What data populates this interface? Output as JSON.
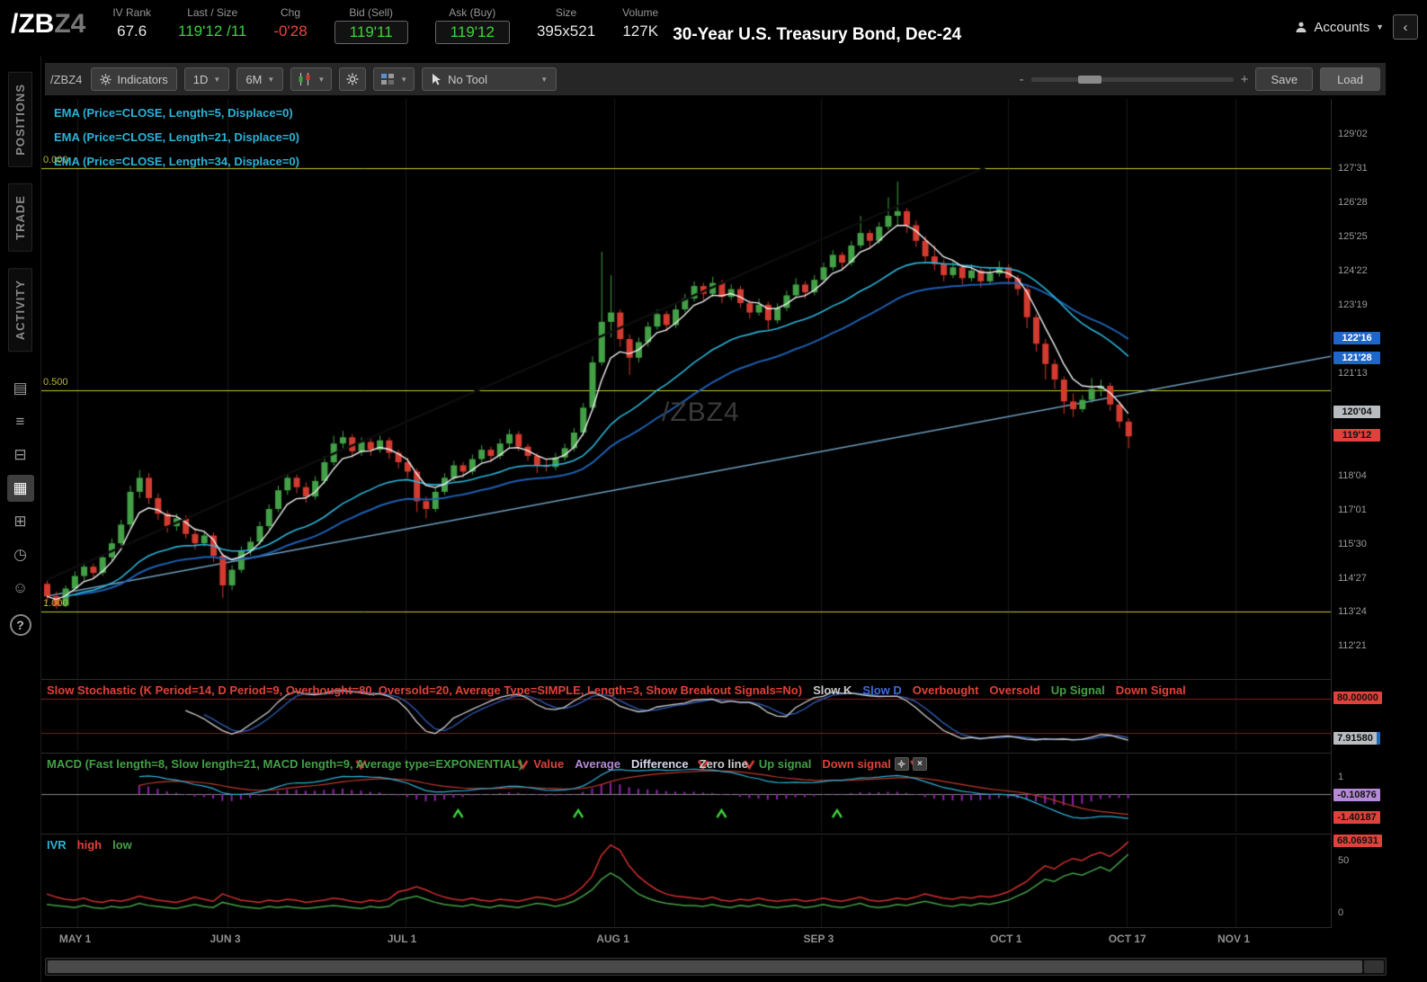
{
  "colors": {
    "up": "#43a047",
    "down": "#d23b30",
    "green_text": "#3fd13f",
    "red_text": "#e8483f",
    "ema5": "#f0f0f0",
    "ema21": "#2bb3d8",
    "ema34": "#1d5fb0",
    "yellow_level": "#c9c92a",
    "support_line": "#6f9fc0",
    "dark_trendline": "#0d0d0d",
    "stoch_k": "#cfcfcf",
    "stoch_d": "#2f5fb8",
    "stoch_band": "#7f1f1f",
    "macd_value": "#2bb3d8",
    "macd_avg": "#c0392b",
    "macd_hist": "#8e24aa",
    "ivr_high": "#d32f2f",
    "ivr_low": "#43a047",
    "badge_blue": "#1f66c9",
    "badge_gray": "#b9bdc2",
    "badge_red": "#e0413a",
    "badge_purple": "#b48ad6",
    "grid": "#181818"
  },
  "header": {
    "symbol_main": "/ZB",
    "symbol_suffix": "Z4",
    "stats": [
      {
        "label": "IV Rank",
        "value": "67.6",
        "style": "white"
      },
      {
        "label": "Last / Size",
        "value": "119'12 /11",
        "style": "green"
      },
      {
        "label": "Chg",
        "value": "-0'28",
        "style": "red"
      },
      {
        "label": "Bid (Sell)",
        "value": "119'11",
        "style": "green",
        "boxed": true
      },
      {
        "label": "Ask (Buy)",
        "value": "119'12",
        "style": "green",
        "boxed": true
      },
      {
        "label": "Size",
        "value": "395x521",
        "style": "white"
      },
      {
        "label": "Volume",
        "value": "127K",
        "style": "white"
      }
    ],
    "title": "30-Year U.S. Treasury Bond, Dec-24",
    "accounts_label": "Accounts",
    "collapse_glyph": "‹"
  },
  "sidebar": {
    "tabs": [
      "POSITIONS",
      "TRADE",
      "ACTIVITY"
    ],
    "icons": [
      {
        "name": "report-icon",
        "glyph": "▤",
        "active": false
      },
      {
        "name": "list-icon",
        "glyph": "≡",
        "active": false
      },
      {
        "name": "orders-icon",
        "glyph": "⊟",
        "active": false
      },
      {
        "name": "chart-icon",
        "glyph": "▦",
        "active": true
      },
      {
        "name": "dashboard-grid-icon",
        "glyph": "⊞",
        "active": false
      },
      {
        "name": "history-clock-icon",
        "glyph": "◷",
        "active": false
      },
      {
        "name": "clients-icon",
        "glyph": "☺",
        "active": false
      }
    ],
    "help_label": "?"
  },
  "toolbar": {
    "symbol": "/ZBZ4",
    "indicators_label": "Indicators",
    "timeframe": "1D",
    "range": "6M",
    "tool_label": "No Tool",
    "zoom_minus": "-",
    "zoom_plus": "+",
    "save_label": "Save",
    "load_label": "Load"
  },
  "chart": {
    "watermark": "/ZBZ4",
    "ema_labels": [
      "EMA (Price=CLOSE, Length=5, Displace=0)",
      "EMA (Price=CLOSE, Length=21, Displace=0)",
      "EMA (Price=CLOSE, Length=34, Displace=0)"
    ],
    "fib_levels": [
      {
        "label": "0.000",
        "price": 127.969
      },
      {
        "label": "0.500",
        "price": 120.859
      },
      {
        "label": "1.000",
        "price": 113.75
      }
    ],
    "axis_ticks": [
      {
        "label": "129'02",
        "price": 129.0625
      },
      {
        "label": "127'31",
        "price": 127.96875
      },
      {
        "label": "126'28",
        "price": 126.875
      },
      {
        "label": "125'25",
        "price": 125.78125
      },
      {
        "label": "124'22",
        "price": 124.6875
      },
      {
        "label": "123'19",
        "price": 123.59375
      },
      {
        "label": "121'13",
        "price": 121.40625
      },
      {
        "label": "118'04",
        "price": 118.125
      },
      {
        "label": "117'01",
        "price": 117.03125
      },
      {
        "label": "115'30",
        "price": 115.9375
      },
      {
        "label": "114'27",
        "price": 114.84375
      },
      {
        "label": "113'24",
        "price": 113.75
      },
      {
        "label": "112'21",
        "price": 112.65625
      }
    ],
    "axis_badges": [
      {
        "label": "122'16",
        "price": 122.5,
        "bg": "#1f66c9",
        "fg": "#fff"
      },
      {
        "label": "121'28",
        "price": 121.875,
        "bg": "#1f66c9",
        "fg": "#fff"
      },
      {
        "label": "120'04",
        "price": 120.125,
        "bg": "#b9bdc2",
        "fg": "#111"
      },
      {
        "label": "119'12",
        "price": 119.375,
        "bg": "#e0413a",
        "fg": "#111"
      }
    ],
    "price_top": 130.2,
    "price_bottom": 111.6
  },
  "stoch": {
    "title": "Slow Stochastic (K Period=14, D Period=9, Overbought=80, Oversold=20, Average Type=SIMPLE, Length=3, Show Breakout Signals=No)",
    "legend": [
      {
        "text": "Slow K",
        "color": "#c8c8c8"
      },
      {
        "text": "Slow D",
        "color": "#3f6bd8"
      },
      {
        "text": "Overbought",
        "color": "#e0413a"
      },
      {
        "text": "Oversold",
        "color": "#e0413a"
      },
      {
        "text": "Up Signal",
        "color": "#43a047"
      },
      {
        "text": "Down Signal",
        "color": "#e0413a"
      }
    ],
    "overbought": 80,
    "oversold": 20,
    "badges": [
      {
        "label": "80.00000",
        "value": 80,
        "bg": "#e0413a",
        "fg": "#111"
      },
      {
        "label": "7.91580",
        "value": 7.9158,
        "bg": "#b9bdc2",
        "fg": "#111",
        "edge": "#1f66c9"
      }
    ]
  },
  "macd": {
    "title": "MACD (Fast length=8, Slow length=21, MACD length=9, Average type=EXPONENTIAL)",
    "legend": [
      {
        "text": "Value",
        "color": "#e0413a"
      },
      {
        "text": "Average",
        "color": "#b48ad6"
      },
      {
        "text": "Difference",
        "color": "#d8d8ee"
      },
      {
        "text": "Zero line",
        "color": "#cccccc"
      },
      {
        "text": "Up signal",
        "color": "#43a047"
      },
      {
        "text": "Down signal",
        "color": "#e0413a"
      }
    ],
    "close_glyph": "×",
    "axis_plain": [
      {
        "label": "1",
        "value": 1
      }
    ],
    "badges": [
      {
        "label": "-0.10876",
        "value": -0.10876,
        "bg": "#b48ad6",
        "fg": "#111"
      },
      {
        "label": "-1.40187",
        "value": -1.40187,
        "bg": "#e0413a",
        "fg": "#111"
      }
    ],
    "up_signals": [
      44.5,
      57.5,
      73,
      85.5
    ],
    "down_signals": [
      34,
      51.5,
      71,
      76,
      94
    ]
  },
  "ivr": {
    "title": "IVR",
    "legend": [
      {
        "text": "high",
        "color": "#e0413a"
      },
      {
        "text": "low",
        "color": "#43a047"
      }
    ],
    "axis_plain": [
      {
        "label": "50",
        "value": 50
      },
      {
        "label": "0",
        "value": 0
      }
    ],
    "badges": [
      {
        "label": "68.06931",
        "value": 68.069,
        "bg": "#e0413a",
        "fg": "#111"
      }
    ]
  },
  "chart_data": {
    "type": "candlestick",
    "symbol": "/ZBZ4",
    "title": "30-Year U.S. Treasury Bond, Dec-24, 1D 6M",
    "ylim": [
      111.6,
      130.2
    ],
    "month_ticks": [
      {
        "label": "MAY 1",
        "index": 3.3
      },
      {
        "label": "JUN 3",
        "index": 19.6
      },
      {
        "label": "JUL 1",
        "index": 38.8
      },
      {
        "label": "AUG 1",
        "index": 61.4
      },
      {
        "label": "SEP 3",
        "index": 83.8
      },
      {
        "label": "OCT 1",
        "index": 104
      },
      {
        "label": "OCT 17",
        "index": 116.8
      },
      {
        "label": "NOV 1",
        "index": 128.6
      }
    ],
    "trendlines": [
      {
        "name": "support-trendline",
        "color": "#6f9fc0",
        "width": 1.5,
        "from": {
          "i": 0,
          "p": 114.25
        },
        "to": {
          "i": 139,
          "p": 121.95
        }
      },
      {
        "name": "dark-trendline",
        "color": "#0d0d0d",
        "width": 2.5,
        "from": {
          "i": 0,
          "p": 114.78
        },
        "to": {
          "i": 101.5,
          "p": 128.0
        }
      }
    ],
    "candles": [
      [
        114.65,
        114.75,
        114.05,
        114.25
      ],
      [
        114.25,
        114.4,
        113.85,
        113.95
      ],
      [
        113.95,
        114.6,
        113.9,
        114.5
      ],
      [
        114.5,
        115.05,
        114.4,
        114.9
      ],
      [
        114.9,
        115.35,
        114.75,
        115.2
      ],
      [
        115.2,
        115.3,
        114.85,
        115.0
      ],
      [
        115.0,
        115.6,
        114.9,
        115.5
      ],
      [
        115.5,
        116.1,
        115.4,
        115.95
      ],
      [
        115.95,
        116.7,
        115.85,
        116.55
      ],
      [
        116.55,
        117.8,
        116.45,
        117.6
      ],
      [
        117.6,
        118.3,
        117.4,
        118.05
      ],
      [
        118.05,
        118.2,
        117.2,
        117.4
      ],
      [
        117.4,
        117.55,
        116.7,
        116.9
      ],
      [
        116.9,
        117.0,
        116.3,
        116.5
      ],
      [
        116.5,
        116.9,
        116.35,
        116.75
      ],
      [
        116.75,
        116.85,
        116.1,
        116.25
      ],
      [
        116.25,
        116.45,
        115.75,
        115.95
      ],
      [
        115.95,
        116.35,
        115.85,
        116.2
      ],
      [
        116.2,
        116.3,
        115.35,
        115.55
      ],
      [
        115.55,
        115.65,
        114.2,
        114.6
      ],
      [
        114.6,
        115.25,
        114.45,
        115.1
      ],
      [
        115.1,
        115.85,
        115.0,
        115.7
      ],
      [
        115.7,
        116.15,
        115.55,
        116.0
      ],
      [
        116.0,
        116.65,
        115.9,
        116.5
      ],
      [
        116.5,
        117.2,
        116.4,
        117.05
      ],
      [
        117.05,
        117.8,
        116.95,
        117.65
      ],
      [
        117.65,
        118.2,
        117.5,
        118.05
      ],
      [
        118.05,
        118.15,
        117.55,
        117.75
      ],
      [
        117.75,
        117.9,
        117.25,
        117.45
      ],
      [
        117.45,
        118.1,
        117.35,
        117.95
      ],
      [
        117.95,
        118.75,
        117.85,
        118.55
      ],
      [
        118.55,
        119.4,
        118.45,
        119.15
      ],
      [
        119.15,
        119.55,
        119.0,
        119.35
      ],
      [
        119.35,
        119.45,
        118.7,
        118.9
      ],
      [
        118.9,
        119.35,
        118.75,
        119.2
      ],
      [
        119.2,
        119.3,
        118.75,
        118.95
      ],
      [
        118.95,
        119.4,
        118.85,
        119.25
      ],
      [
        119.25,
        119.35,
        118.65,
        118.85
      ],
      [
        118.85,
        118.95,
        118.35,
        118.55
      ],
      [
        118.55,
        118.7,
        118.05,
        118.25
      ],
      [
        118.25,
        118.35,
        116.95,
        117.3
      ],
      [
        117.3,
        117.45,
        116.75,
        117.05
      ],
      [
        117.05,
        117.75,
        116.95,
        117.6
      ],
      [
        117.6,
        118.2,
        117.5,
        118.05
      ],
      [
        118.05,
        118.6,
        117.95,
        118.45
      ],
      [
        118.45,
        118.55,
        118.05,
        118.25
      ],
      [
        118.25,
        118.8,
        118.15,
        118.65
      ],
      [
        118.65,
        119.1,
        118.55,
        118.95
      ],
      [
        118.95,
        119.05,
        118.55,
        118.75
      ],
      [
        118.75,
        119.3,
        118.65,
        119.15
      ],
      [
        119.15,
        119.6,
        119.0,
        119.45
      ],
      [
        119.45,
        119.55,
        118.9,
        119.05
      ],
      [
        119.05,
        119.15,
        118.6,
        118.75
      ],
      [
        118.75,
        118.85,
        118.2,
        118.45
      ],
      [
        118.45,
        118.65,
        118.25,
        118.4
      ],
      [
        118.4,
        118.85,
        118.3,
        118.7
      ],
      [
        118.7,
        119.15,
        118.6,
        119.0
      ],
      [
        119.0,
        119.65,
        118.9,
        119.5
      ],
      [
        119.5,
        120.45,
        119.4,
        120.3
      ],
      [
        120.3,
        121.95,
        120.2,
        121.75
      ],
      [
        121.75,
        125.3,
        121.65,
        123.05
      ],
      [
        123.05,
        124.55,
        122.55,
        123.35
      ],
      [
        123.35,
        123.45,
        122.25,
        122.5
      ],
      [
        122.5,
        122.65,
        121.35,
        121.9
      ],
      [
        121.9,
        122.55,
        121.75,
        122.4
      ],
      [
        122.4,
        123.05,
        122.25,
        122.9
      ],
      [
        122.9,
        123.45,
        122.8,
        123.3
      ],
      [
        123.3,
        123.4,
        122.75,
        122.95
      ],
      [
        122.95,
        123.6,
        122.85,
        123.45
      ],
      [
        123.45,
        123.95,
        123.35,
        123.8
      ],
      [
        123.8,
        124.35,
        123.7,
        124.2
      ],
      [
        124.2,
        124.3,
        123.75,
        123.95
      ],
      [
        123.95,
        124.5,
        123.85,
        124.3
      ],
      [
        124.3,
        124.4,
        123.65,
        123.85
      ],
      [
        123.85,
        124.25,
        123.75,
        124.1
      ],
      [
        124.1,
        124.2,
        123.5,
        123.65
      ],
      [
        123.65,
        123.75,
        123.15,
        123.35
      ],
      [
        123.35,
        123.8,
        123.25,
        123.6
      ],
      [
        123.6,
        123.7,
        122.8,
        123.1
      ],
      [
        123.1,
        123.65,
        123.0,
        123.5
      ],
      [
        123.5,
        124.05,
        123.4,
        123.9
      ],
      [
        123.9,
        124.45,
        123.8,
        124.25
      ],
      [
        124.25,
        124.35,
        123.8,
        124.0
      ],
      [
        124.0,
        124.55,
        123.9,
        124.4
      ],
      [
        124.4,
        124.95,
        124.3,
        124.8
      ],
      [
        124.8,
        125.35,
        124.7,
        125.2
      ],
      [
        125.2,
        125.3,
        124.75,
        124.95
      ],
      [
        124.95,
        125.65,
        124.85,
        125.5
      ],
      [
        125.5,
        126.45,
        125.4,
        125.9
      ],
      [
        125.9,
        126.0,
        125.4,
        125.65
      ],
      [
        125.65,
        126.25,
        125.55,
        126.1
      ],
      [
        126.1,
        127.05,
        126.0,
        126.45
      ],
      [
        126.45,
        127.55,
        126.15,
        126.6
      ],
      [
        126.6,
        126.7,
        125.9,
        126.15
      ],
      [
        126.15,
        126.3,
        125.45,
        125.65
      ],
      [
        125.65,
        125.8,
        124.95,
        125.15
      ],
      [
        125.15,
        125.5,
        124.7,
        124.9
      ],
      [
        124.9,
        125.05,
        124.35,
        124.55
      ],
      [
        124.55,
        125.0,
        124.45,
        124.8
      ],
      [
        124.8,
        124.9,
        124.25,
        124.45
      ],
      [
        124.45,
        124.9,
        124.35,
        124.7
      ],
      [
        124.7,
        124.8,
        124.15,
        124.35
      ],
      [
        124.35,
        124.8,
        124.25,
        124.6
      ],
      [
        124.6,
        125.0,
        124.5,
        124.8
      ],
      [
        124.8,
        124.9,
        124.25,
        124.45
      ],
      [
        124.45,
        124.55,
        123.9,
        124.1
      ],
      [
        124.1,
        124.2,
        122.85,
        123.2
      ],
      [
        123.2,
        123.3,
        122.1,
        122.35
      ],
      [
        122.35,
        122.5,
        121.2,
        121.7
      ],
      [
        121.7,
        121.85,
        120.9,
        121.2
      ],
      [
        121.2,
        121.3,
        120.1,
        120.5
      ],
      [
        120.5,
        120.75,
        120.0,
        120.25
      ],
      [
        120.25,
        120.7,
        120.15,
        120.55
      ],
      [
        120.55,
        121.25,
        120.45,
        120.9
      ],
      [
        120.9,
        121.2,
        120.65,
        121.0
      ],
      [
        121.0,
        121.1,
        120.2,
        120.4
      ],
      [
        120.4,
        120.5,
        119.65,
        119.85
      ],
      [
        119.85,
        119.95,
        119.0,
        119.38
      ]
    ],
    "ivr_high": [
      18,
      15,
      13,
      12,
      14,
      11,
      10,
      12,
      11,
      13,
      16,
      14,
      12,
      11,
      10,
      12,
      15,
      13,
      11,
      18,
      15,
      12,
      11,
      10,
      12,
      11,
      13,
      12,
      10,
      11,
      12,
      14,
      13,
      11,
      10,
      12,
      11,
      13,
      20,
      22,
      25,
      22,
      18,
      15,
      13,
      12,
      14,
      12,
      11,
      13,
      12,
      11,
      13,
      15,
      14,
      12,
      14,
      18,
      25,
      35,
      55,
      65,
      60,
      45,
      35,
      28,
      22,
      18,
      16,
      15,
      14,
      13,
      15,
      12,
      11,
      13,
      12,
      14,
      12,
      11,
      12,
      13,
      11,
      12,
      14,
      12,
      11,
      13,
      15,
      12,
      11,
      12,
      14,
      13,
      15,
      18,
      16,
      14,
      13,
      15,
      14,
      16,
      15,
      17,
      20,
      25,
      30,
      38,
      45,
      42,
      48,
      52,
      50,
      55,
      58,
      54,
      60,
      68
    ],
    "ivr_low": [
      8,
      7,
      6,
      5,
      7,
      5,
      4,
      6,
      5,
      6,
      9,
      7,
      6,
      5,
      4,
      6,
      8,
      6,
      5,
      10,
      8,
      6,
      5,
      4,
      6,
      5,
      6,
      5,
      4,
      5,
      6,
      7,
      6,
      5,
      4,
      6,
      5,
      6,
      12,
      14,
      16,
      13,
      10,
      8,
      7,
      6,
      8,
      6,
      5,
      7,
      6,
      5,
      7,
      9,
      8,
      6,
      8,
      11,
      16,
      22,
      32,
      38,
      33,
      25,
      18,
      14,
      11,
      9,
      8,
      7,
      7,
      6,
      8,
      6,
      5,
      7,
      6,
      8,
      6,
      5,
      6,
      7,
      5,
      6,
      8,
      6,
      5,
      7,
      9,
      6,
      5,
      6,
      8,
      7,
      9,
      11,
      9,
      7,
      6,
      8,
      7,
      9,
      8,
      10,
      12,
      16,
      20,
      26,
      32,
      30,
      35,
      38,
      36,
      40,
      44,
      40,
      48,
      56
    ]
  }
}
